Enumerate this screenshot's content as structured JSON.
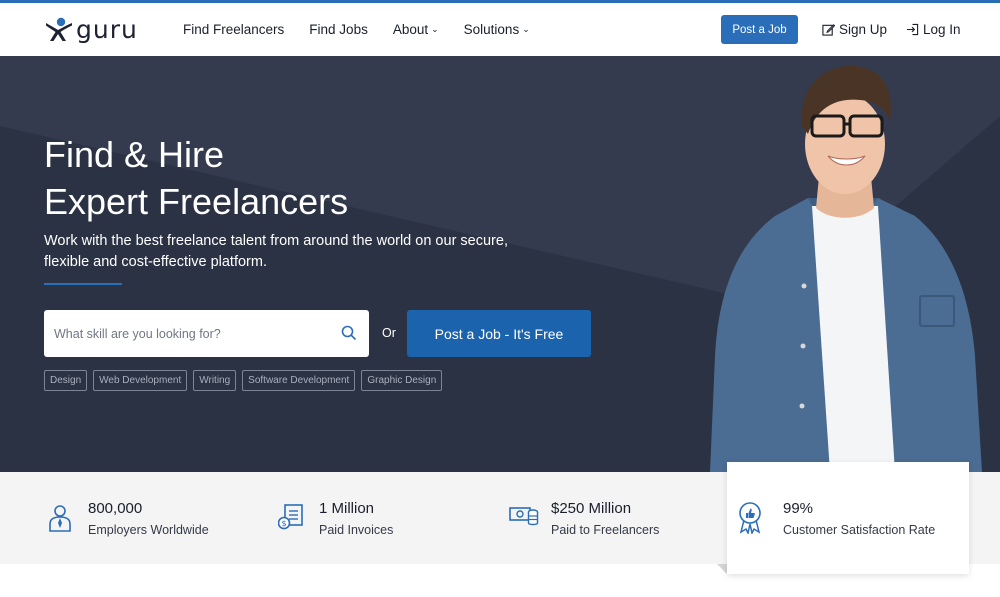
{
  "brand": {
    "logo_text": "guru",
    "accent": "#2a6db8",
    "hero_bg": "#2b3244"
  },
  "nav": {
    "links": [
      {
        "label": "Find Freelancers",
        "dropdown": false
      },
      {
        "label": "Find Jobs",
        "dropdown": false
      },
      {
        "label": "About",
        "dropdown": true
      },
      {
        "label": "Solutions",
        "dropdown": true
      }
    ],
    "post_job_label": "Post a Job",
    "signup_label": "Sign Up",
    "login_label": "Log In"
  },
  "hero": {
    "title_line1": "Find & Hire",
    "title_line2": "Expert Freelancers",
    "subtitle": "Work with the best freelance talent from around the world on our secure, flexible and cost-effective platform.",
    "search_placeholder": "What skill are you looking for?",
    "or_text": "Or",
    "cta_label": "Post a Job - It's Free",
    "tags": [
      "Design",
      "Web Development",
      "Writing",
      "Software Development",
      "Graphic Design"
    ]
  },
  "stats": [
    {
      "icon": "employer-icon",
      "number": "800,000",
      "label": "Employers Worldwide"
    },
    {
      "icon": "invoice-icon",
      "number": "1 Million",
      "label": "Paid Invoices"
    },
    {
      "icon": "money-icon",
      "number": "$250 Million",
      "label": "Paid to Freelancers"
    },
    {
      "icon": "award-icon",
      "number": "99%",
      "label": "Customer Satisfaction Rate"
    }
  ]
}
